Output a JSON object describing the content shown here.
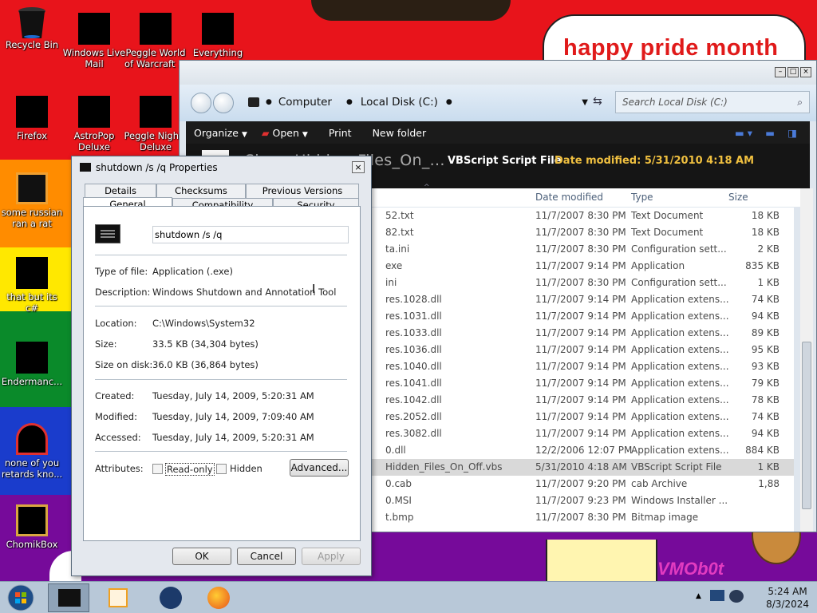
{
  "wallpaper": {
    "banner_text": "happy pride month",
    "corner_text": "VMOb0t",
    "colors": [
      "#e8141b",
      "#ff8c00",
      "#ffe800",
      "#0a8a2a",
      "#1a3ccc",
      "#760a9a"
    ]
  },
  "desktop_icons": [
    {
      "label": "Recycle Bin",
      "icon": "recycle-bin-icon"
    },
    {
      "label": "Windows Live Mail",
      "icon": "mail-icon"
    },
    {
      "label": "Peggle World of Warcraft ...",
      "icon": "game-icon"
    },
    {
      "label": "Everything",
      "icon": "search-app-icon"
    },
    {
      "label": "Firefox",
      "icon": "firefox-icon"
    },
    {
      "label": "AstroPop Deluxe",
      "icon": "game-icon"
    },
    {
      "label": "Peggle Nights Deluxe",
      "icon": "game-icon"
    },
    {
      "label": "some russian ran a rat",
      "icon": "java-file-icon"
    },
    {
      "label": "that but its c#",
      "icon": "file-icon"
    },
    {
      "label": "Endermanc...",
      "icon": "app-icon"
    },
    {
      "label": "none of you retards kno...",
      "icon": "app-icon"
    },
    {
      "label": "ChomikBox",
      "icon": "chomikbox-icon"
    }
  ],
  "explorer": {
    "breadcrumb": [
      "Computer",
      "Local Disk (C:)"
    ],
    "search_placeholder": "Search Local Disk (C:)",
    "toolbar": [
      "Organize",
      "Open",
      "Print",
      "New folder"
    ],
    "details": {
      "title": "Show_Hidden_Files_On_...",
      "type": "VBScript Script File",
      "modified": "Date modified: 5/31/2010 4:18 AM"
    },
    "columns": [
      "Date modified",
      "Type",
      "Size"
    ],
    "files": [
      {
        "name": "52.txt",
        "date": "11/7/2007 8:30 PM",
        "type": "Text Document",
        "size": "18 KB"
      },
      {
        "name": "82.txt",
        "date": "11/7/2007 8:30 PM",
        "type": "Text Document",
        "size": "18 KB"
      },
      {
        "name": "ta.ini",
        "date": "11/7/2007 8:30 PM",
        "type": "Configuration sett...",
        "size": "2 KB"
      },
      {
        "name": "exe",
        "date": "11/7/2007 9:14 PM",
        "type": "Application",
        "size": "835 KB"
      },
      {
        "name": "ini",
        "date": "11/7/2007 8:30 PM",
        "type": "Configuration sett...",
        "size": "1 KB"
      },
      {
        "name": "res.1028.dll",
        "date": "11/7/2007 9:14 PM",
        "type": "Application extens...",
        "size": "74 KB"
      },
      {
        "name": "res.1031.dll",
        "date": "11/7/2007 9:14 PM",
        "type": "Application extens...",
        "size": "94 KB"
      },
      {
        "name": "res.1033.dll",
        "date": "11/7/2007 9:14 PM",
        "type": "Application extens...",
        "size": "89 KB"
      },
      {
        "name": "res.1036.dll",
        "date": "11/7/2007 9:14 PM",
        "type": "Application extens...",
        "size": "95 KB"
      },
      {
        "name": "res.1040.dll",
        "date": "11/7/2007 9:14 PM",
        "type": "Application extens...",
        "size": "93 KB"
      },
      {
        "name": "res.1041.dll",
        "date": "11/7/2007 9:14 PM",
        "type": "Application extens...",
        "size": "79 KB"
      },
      {
        "name": "res.1042.dll",
        "date": "11/7/2007 9:14 PM",
        "type": "Application extens...",
        "size": "78 KB"
      },
      {
        "name": "res.2052.dll",
        "date": "11/7/2007 9:14 PM",
        "type": "Application extens...",
        "size": "74 KB"
      },
      {
        "name": "res.3082.dll",
        "date": "11/7/2007 9:14 PM",
        "type": "Application extens...",
        "size": "94 KB"
      },
      {
        "name": "0.dll",
        "date": "12/2/2006 12:07 PM",
        "type": "Application extens...",
        "size": "884 KB"
      },
      {
        "name": "Hidden_Files_On_Off.vbs",
        "date": "5/31/2010 4:18 AM",
        "type": "VBScript Script File",
        "size": "1 KB",
        "selected": true
      },
      {
        "name": "0.cab",
        "date": "11/7/2007 9:20 PM",
        "type": "cab Archive",
        "size": "1,88"
      },
      {
        "name": "0.MSI",
        "date": "11/7/2007 9:23 PM",
        "type": "Windows Installer ...",
        "size": ""
      },
      {
        "name": "t.bmp",
        "date": "11/7/2007 8:30 PM",
        "type": "Bitmap image",
        "size": ""
      }
    ]
  },
  "dialog": {
    "title": "shutdown /s /q Properties",
    "tabs_top": [
      "Details",
      "Checksums",
      "Previous Versions"
    ],
    "tabs_bottom": [
      "General",
      "Compatibility",
      "Security"
    ],
    "name_value": "shutdown /s /q",
    "type_label": "Type of file:",
    "type_value": "Application (.exe)",
    "desc_label": "Description:",
    "desc_value": "Windows Shutdown and Annotation Tool",
    "location_label": "Location:",
    "location_value": "C:\\Windows\\System32",
    "size_label": "Size:",
    "size_value": "33.5 KB (34,304 bytes)",
    "sizedisk_label": "Size on disk:",
    "sizedisk_value": "36.0 KB (36,864 bytes)",
    "created_label": "Created:",
    "created_value": "Tuesday, July 14, 2009, 5:20:31 AM",
    "modified_label": "Modified:",
    "modified_value": "Tuesday, July 14, 2009, 7:09:40 AM",
    "accessed_label": "Accessed:",
    "accessed_value": "Tuesday, July 14, 2009, 5:20:31 AM",
    "attributes_label": "Attributes:",
    "readonly_label": "Read-only",
    "hidden_label": "Hidden",
    "advanced_label": "Advanced...",
    "ok_label": "OK",
    "cancel_label": "Cancel",
    "apply_label": "Apply"
  },
  "taskbar": {
    "time": "5:24 AM",
    "date": "8/3/2024"
  }
}
